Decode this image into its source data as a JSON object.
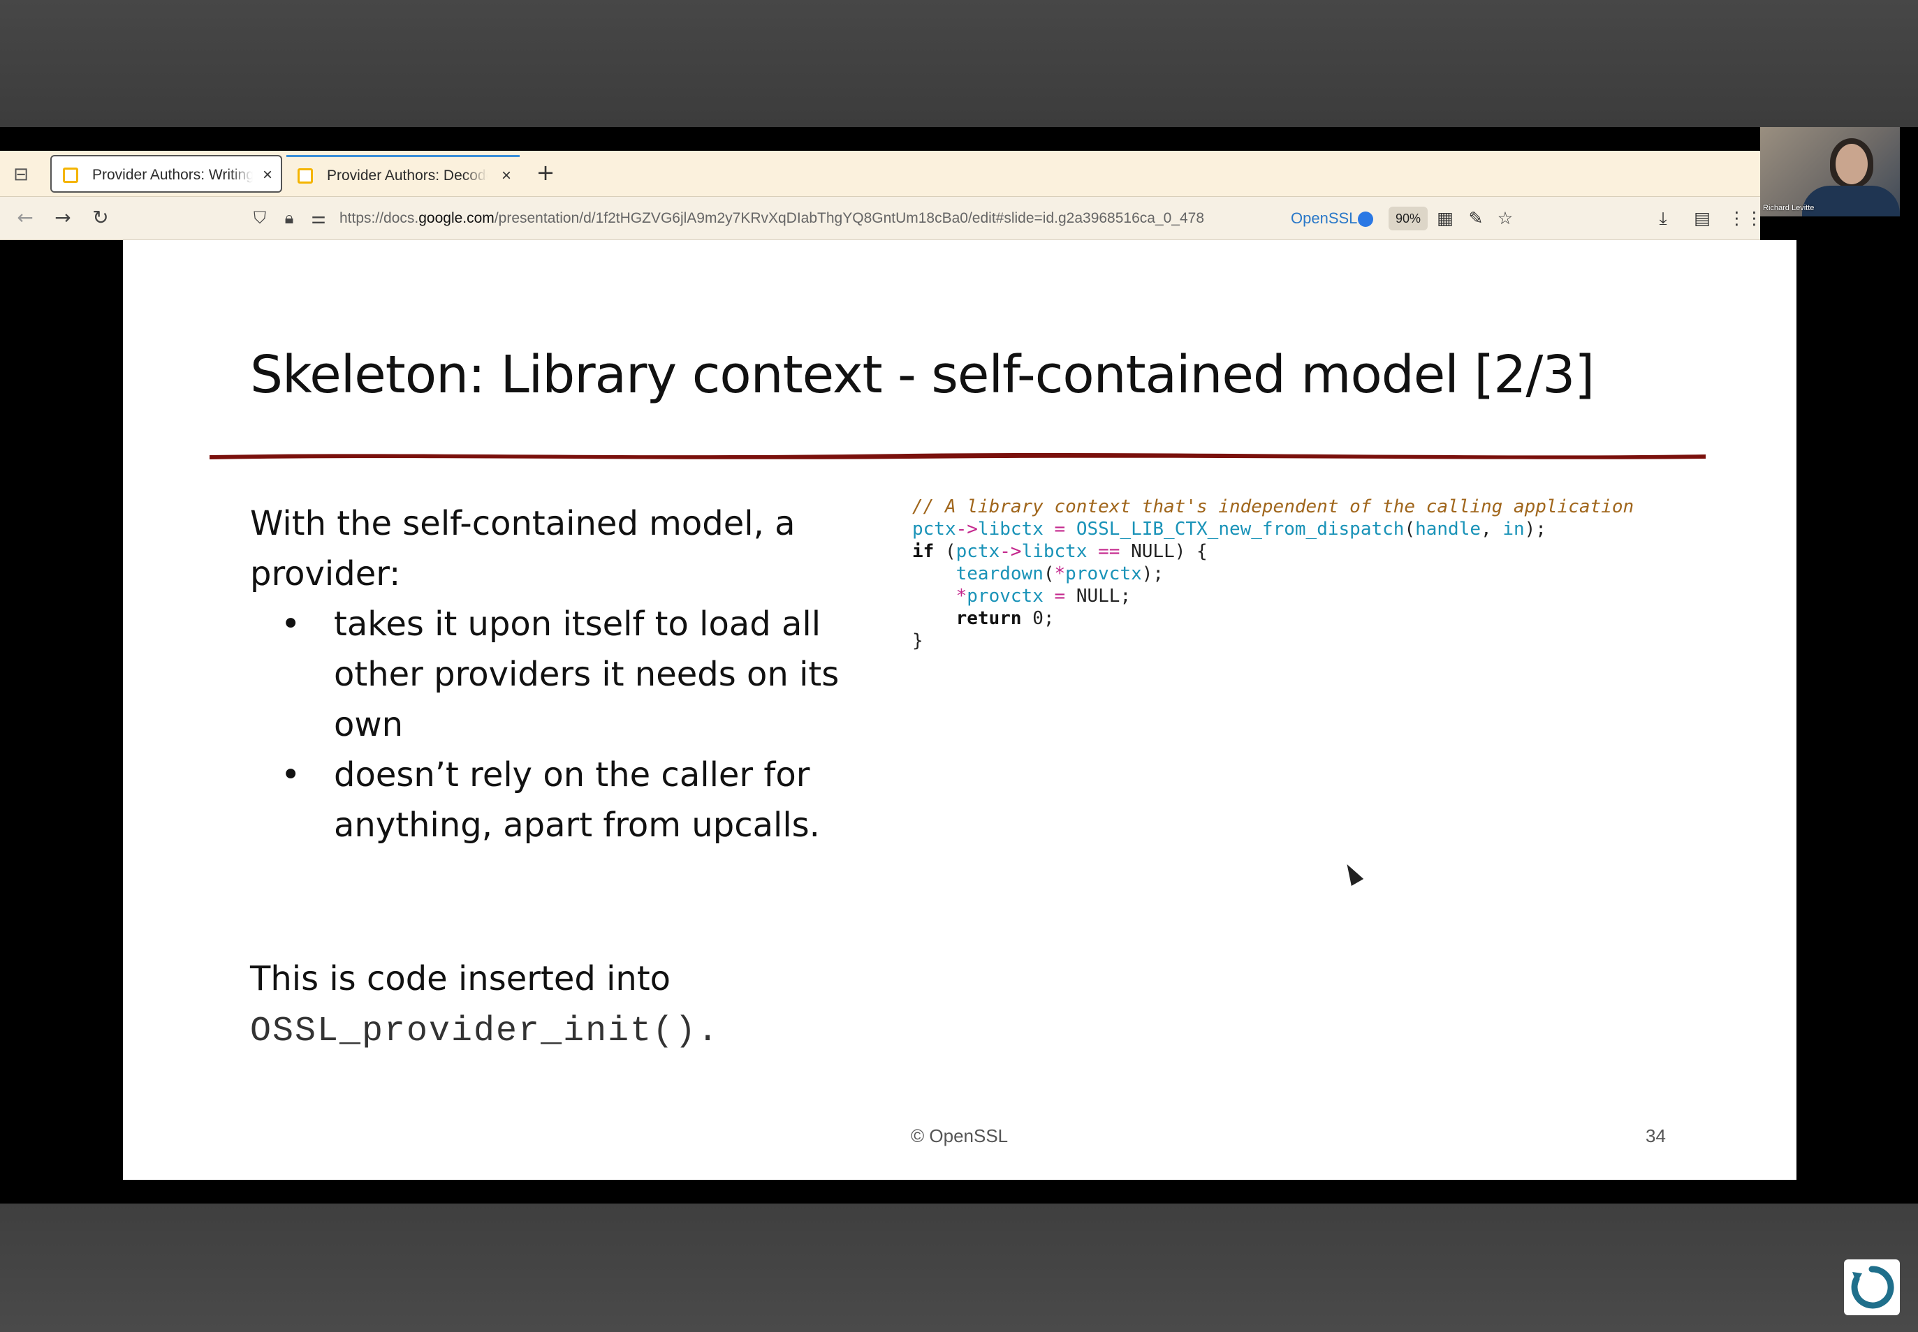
{
  "browser": {
    "tabs": [
      {
        "label": "Provider Authors: Writing a",
        "close": "×"
      },
      {
        "label": "Provider Authors: Decoder",
        "close": "×"
      }
    ],
    "new_tab": "+",
    "url_domain_prefix": "https://docs.",
    "url_domain": "google.com",
    "url_path": "/presentation/d/1f2tHGZVG6jlA9m2y7KRvXqDIabThgYQ8GntUm18cBa0/edit#slide=id.g2a3968516ca_0_478",
    "extension_label": "OpenSSL",
    "zoom": "90%"
  },
  "slide": {
    "title": "Skeleton: Library context - self-contained model [2/3]",
    "intro": "With the self-contained model, a provider:",
    "bullets": [
      "takes it upon itself to load all other providers it needs on its own",
      "doesn’t rely on the caller for anything, apart from upcalls."
    ],
    "bullet_symbol": "•",
    "note_prefix": "This is code inserted into",
    "note_code": "OSSL_provider_init().",
    "code": {
      "comment": "// A library context that's independent of the calling application",
      "line2_a": "pctx",
      "line2_b": "->",
      "line2_c": "libctx",
      "line2_d": " = ",
      "line2_e": "OSSL_LIB_CTX_new_from_dispatch",
      "line2_f": "(",
      "line2_g": "handle",
      "line2_h": ", ",
      "line2_i": "in",
      "line2_j": ");",
      "line3_kw": "if",
      "line3_a": " (",
      "line3_b": "pctx",
      "line3_c": "->",
      "line3_d": "libctx",
      "line3_e": " == ",
      "line3_f": "NULL",
      "line3_g": ") {",
      "line4_a": "teardown",
      "line4_b": "(",
      "line4_c": "*",
      "line4_d": "provctx",
      "line4_e": ");",
      "line5_a": "*",
      "line5_b": "provctx",
      "line5_c": " = ",
      "line5_d": "NULL",
      "line5_e": ";",
      "line6_kw": "return",
      "line6_a": " 0",
      "line6_b": ";",
      "line7": "}"
    },
    "footer": "© OpenSSL",
    "page_number": "34"
  },
  "webcam": {
    "name": "Richard Levitte"
  }
}
